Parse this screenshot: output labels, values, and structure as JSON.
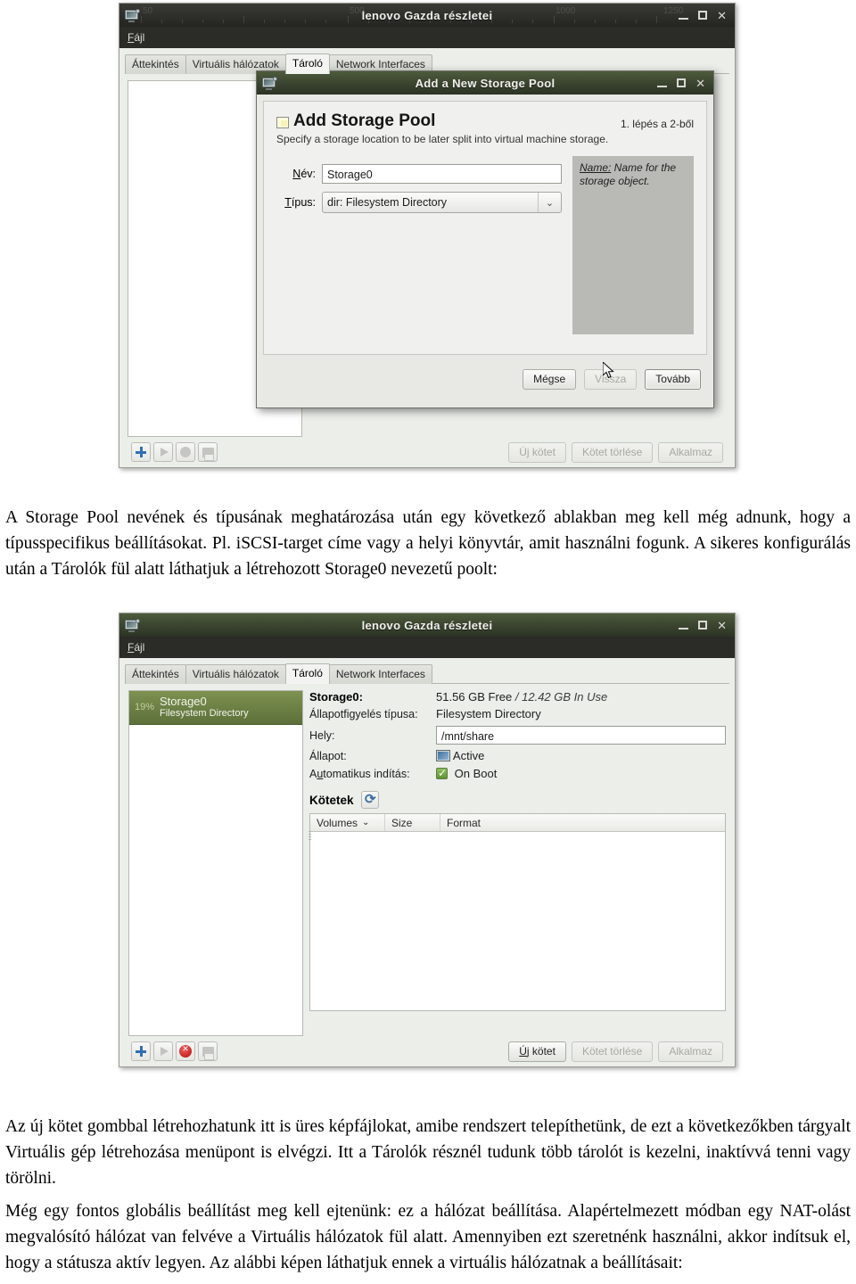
{
  "window1": {
    "title": "lenovo Gazda részletei",
    "menu": [
      "Fájl"
    ],
    "ruler_labels": [
      "50",
      "500",
      "1000",
      "1250"
    ],
    "tabs": [
      {
        "label": "Áttekintés",
        "active": false
      },
      {
        "label": "Virtuális hálózatok",
        "active": false
      },
      {
        "label": "Tároló",
        "active": true
      },
      {
        "label": "Network Interfaces",
        "active": false
      }
    ],
    "toolbar_icons": [
      "plus-icon",
      "play-icon",
      "stop-icon",
      "pause-icon"
    ],
    "footer_buttons": [
      {
        "label": "Új kötet",
        "disabled": true
      },
      {
        "label": "Kötet törlése",
        "disabled": true
      },
      {
        "label": "Alkalmaz",
        "disabled": true
      }
    ]
  },
  "dialog": {
    "title": "Add a New Storage Pool",
    "heading": "Add Storage Pool",
    "step": "1. lépés a 2-ből",
    "subtitle": "Specify a storage location to be later split into virtual machine storage.",
    "fields": [
      {
        "label": "Név:",
        "value": "Storage0",
        "kind": "text"
      },
      {
        "label": "Típus:",
        "value": "dir: Filesystem Directory",
        "kind": "select"
      }
    ],
    "help_term": "Name:",
    "help_text": " Name for the storage object.",
    "buttons": [
      {
        "label": "Mégse",
        "disabled": false,
        "default": false
      },
      {
        "label": "Vissza",
        "disabled": true,
        "default": false
      },
      {
        "label": "Tovább",
        "disabled": false,
        "default": true
      }
    ]
  },
  "paragraph1": "A Storage Pool nevének és típusának meghatározása után egy következő ablakban meg kell még adnunk, hogy a típusspecifikus beállításokat. Pl. iSCSI-target címe vagy a helyi könyvtár, amit használni fogunk. A sikeres konfigurálás után a Tárolók fül alatt láthatjuk a létrehozott Storage0 nevezetű poolt:",
  "window2": {
    "title": "lenovo Gazda részletei",
    "menu": [
      "Fájl"
    ],
    "tabs": [
      {
        "label": "Áttekintés",
        "active": false
      },
      {
        "label": "Virtuális hálózatok",
        "active": false
      },
      {
        "label": "Tároló",
        "active": true
      },
      {
        "label": "Network Interfaces",
        "active": false
      }
    ],
    "pool_list": [
      {
        "percent": "19%",
        "name": "Storage0",
        "type": "Filesystem Directory",
        "selected": true
      }
    ],
    "details": {
      "pool_label": "Storage0:",
      "capacity_free": "51.56 GB Free",
      "capacity_sep": " / ",
      "capacity_used": "12.42 GB In Use",
      "rows": [
        {
          "label": "Állapotfigyelés típusa:",
          "value": "Filesystem Directory"
        },
        {
          "label": "Hely:",
          "value": "/mnt/share"
        },
        {
          "label": "Állapot:",
          "value": "Active"
        },
        {
          "label": "Automatikus indítás:",
          "value": "On Boot"
        }
      ],
      "volumes_title": "Kötetek",
      "refresh_icon": "refresh-icon",
      "volume_columns": [
        "Volumes",
        "Size",
        "Format"
      ],
      "volume_rows": []
    },
    "toolbar_icons": [
      "plus-icon",
      "play-icon",
      "stop-icon",
      "pause-icon"
    ],
    "footer_buttons": [
      {
        "label": "Új kötet",
        "disabled": false
      },
      {
        "label": "Kötet törlése",
        "disabled": true
      },
      {
        "label": "Alkalmaz",
        "disabled": true
      }
    ]
  },
  "paragraph2": "Az új kötet gombbal létrehozhatunk itt is üres képfájlokat, amibe rendszert telepíthetünk, de ezt a következőkben tárgyalt Virtuális gép létrehozása menüpont is elvégzi. Itt a Tárolók résznél tudunk több tárolót is kezelni, inaktívvá tenni vagy törölni.",
  "paragraph3": "Még egy fontos globális beállítást meg kell ejtenünk: ez a hálózat beállítása. Alapértelmezett módban egy NAT-olást megvalósító hálózat van felvéve a Virtuális hálózatok fül alatt. Amennyiben ezt szeretnénk használni, akkor indítsuk el, hogy a státusza aktív legyen. Az alábbi képen láthatjuk ennek a virtuális hálózatnak a beállításait:",
  "colors": {
    "titlebar_dark": "#2e2e2b",
    "titlebar_green": "#3c4630",
    "pool_selected": "#6b7f46",
    "accent_blue": "#2f6fb5",
    "stop_red": "#b30e0e"
  }
}
